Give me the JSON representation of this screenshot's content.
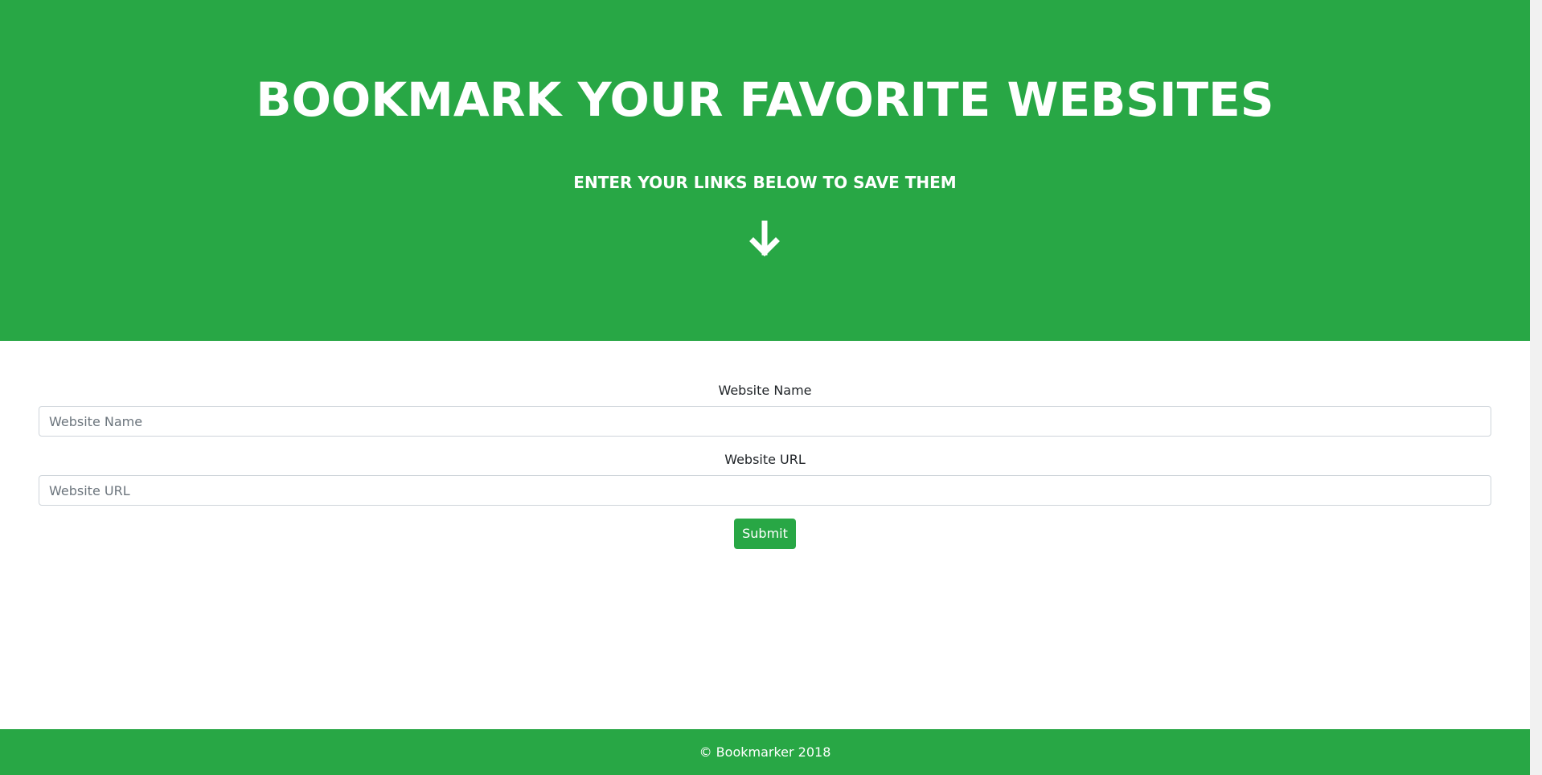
{
  "hero": {
    "title": "BOOKMARK YOUR FAVORITE WEBSITES",
    "subtitle": "ENTER YOUR LINKS BELOW TO SAVE THEM",
    "icon": "arrow-down-icon",
    "background_color": "#28a745"
  },
  "form": {
    "website_name": {
      "label": "Website Name",
      "placeholder": "Website Name",
      "value": ""
    },
    "website_url": {
      "label": "Website URL",
      "placeholder": "Website URL",
      "value": ""
    },
    "submit_label": "Submit",
    "submit_color": "#28a745"
  },
  "footer": {
    "text": "© Bookmarker 2018",
    "background_color": "#28a745"
  }
}
